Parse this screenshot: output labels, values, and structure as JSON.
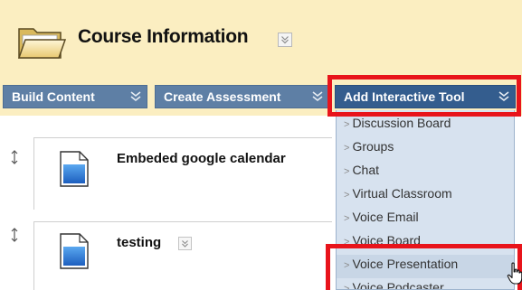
{
  "header": {
    "title": "Course Information"
  },
  "actions": {
    "build_content": "Build Content",
    "create_assessment": "Create Assessment",
    "add_interactive_tool": "Add Interactive Tool"
  },
  "items": [
    {
      "title": "Embeded google calendar"
    },
    {
      "title": "testing"
    }
  ],
  "menu": {
    "items": [
      {
        "label": "Discussion Board"
      },
      {
        "label": "Groups"
      },
      {
        "label": "Chat"
      },
      {
        "label": "Virtual Classroom"
      },
      {
        "label": "Voice Email"
      },
      {
        "label": "Voice Board"
      },
      {
        "label": "Voice Presentation"
      },
      {
        "label": "Voice Podcaster"
      }
    ],
    "hovered_index": 6
  },
  "colors": {
    "header_bg": "#fbeec1",
    "button_bg": "#5e7fa5",
    "button_active_bg": "#345d8e",
    "menu_bg": "#d7e2ef",
    "highlight": "#e8141b"
  }
}
